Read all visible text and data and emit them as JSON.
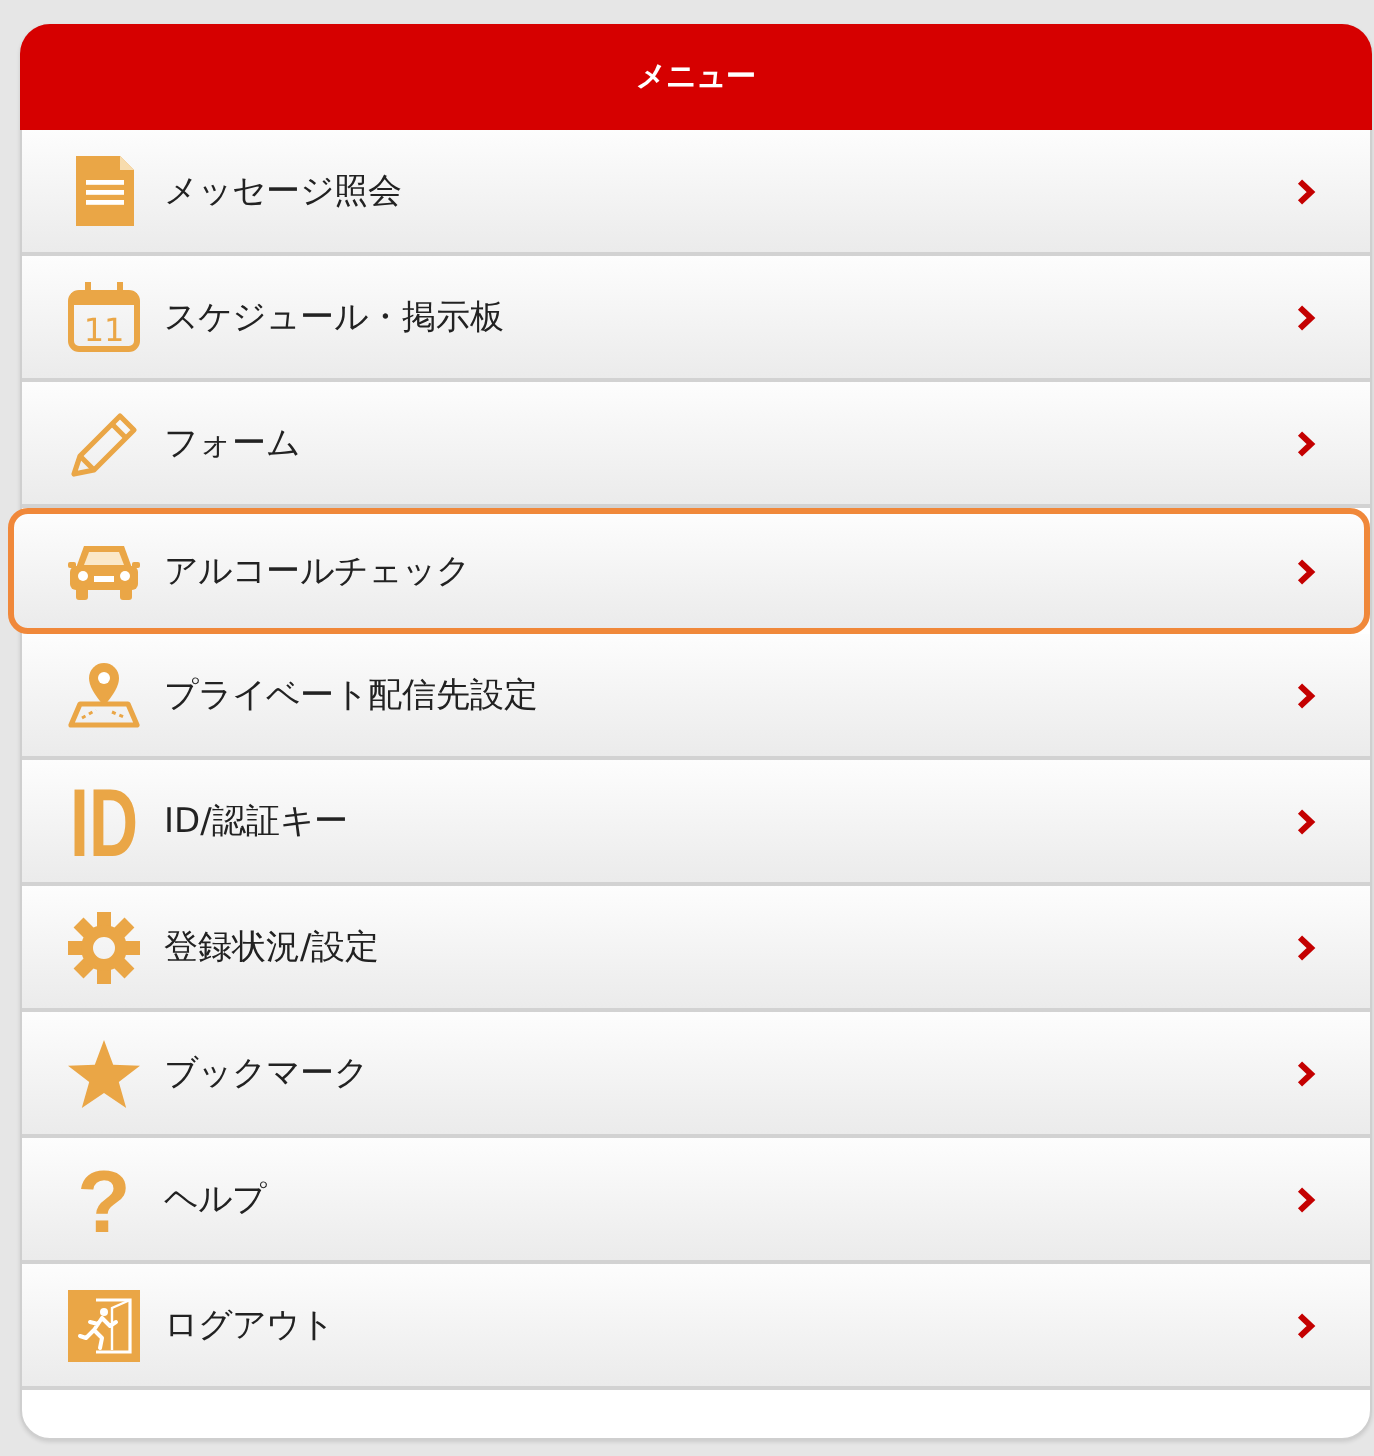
{
  "header": {
    "title": "メニュー"
  },
  "menu": {
    "items": [
      {
        "label": "メッセージ照会",
        "selected": false
      },
      {
        "label": "スケジュール・掲示板",
        "icon_text": "11",
        "selected": false
      },
      {
        "label": "フォーム",
        "selected": false
      },
      {
        "label": "アルコールチェック",
        "selected": true
      },
      {
        "label": "プライベート配信先設定",
        "selected": false
      },
      {
        "label": "ID/認証キー",
        "icon_text": "ID",
        "selected": false
      },
      {
        "label": "登録状況/設定",
        "selected": false
      },
      {
        "label": "ブックマーク",
        "selected": false
      },
      {
        "label": "ヘルプ",
        "icon_text": "?",
        "selected": false
      },
      {
        "label": "ログアウト",
        "selected": false
      }
    ]
  }
}
